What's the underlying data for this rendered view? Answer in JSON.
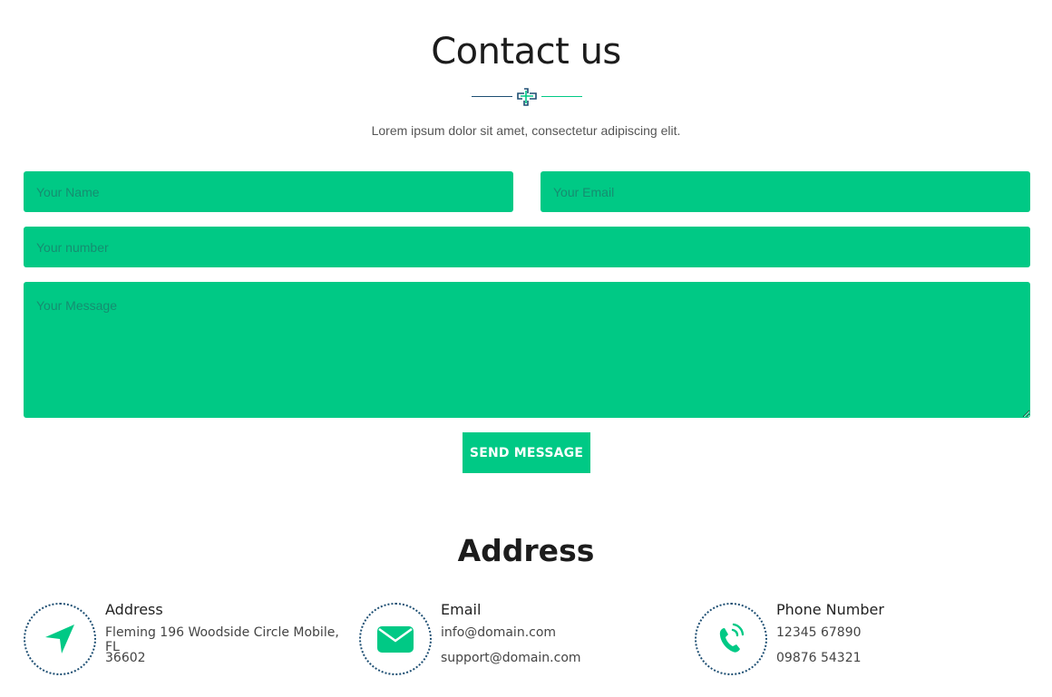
{
  "header": {
    "title": "Contact us",
    "subtitle": "Lorem ipsum dolor sit amet, consectetur adipiscing elit."
  },
  "form": {
    "name_placeholder": "Your Name",
    "email_placeholder": "Your Email",
    "number_placeholder": "Your number",
    "message_placeholder": "Your Message",
    "submit_label": "SEND MESSAGE"
  },
  "address_section": {
    "title": "Address",
    "items": [
      {
        "icon": "location-arrow-icon",
        "heading": "Address",
        "line1": "Fleming 196 Woodside Circle Mobile, FL",
        "line2": "36602"
      },
      {
        "icon": "envelope-icon",
        "heading": "Email",
        "line1": "info@domain.com",
        "line2": "support@domain.com"
      },
      {
        "icon": "phone-icon",
        "heading": "Phone Number",
        "line1": "12345 67890",
        "line2": "09876 54321"
      }
    ]
  },
  "colors": {
    "accent": "#00c985",
    "navy": "#1d4e72",
    "text": "#222222"
  }
}
